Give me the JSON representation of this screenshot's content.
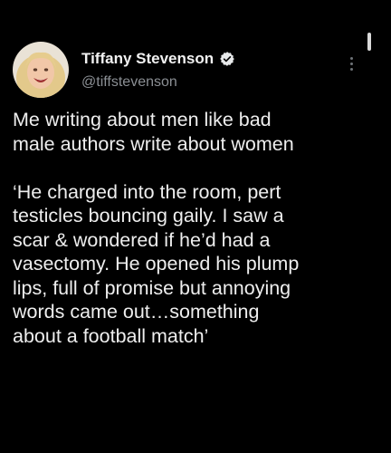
{
  "tweet": {
    "author": {
      "display_name": "Tiffany Stevenson",
      "handle": "@tiffstevenson",
      "verified": true,
      "avatar_icon": "avatar-photo",
      "verified_icon": "verified-badge-icon",
      "menu_icon": "more-vertical-icon"
    },
    "text": {
      "paragraph_1": "Me writing about men like bad\nmale authors write about women",
      "paragraph_2": "‘He charged into the room, pert\ntesticles bouncing gaily. I saw a\nscar & wondered if he’d had a\nvasectomy.  He opened his plump\nlips, full of promise but annoying\nwords came out…something\nabout a football match’"
    }
  },
  "colors": {
    "background": "#000000",
    "text": "#eeeeee",
    "secondary_text": "#8b8f94",
    "verified_badge": "#e7e9ea"
  }
}
